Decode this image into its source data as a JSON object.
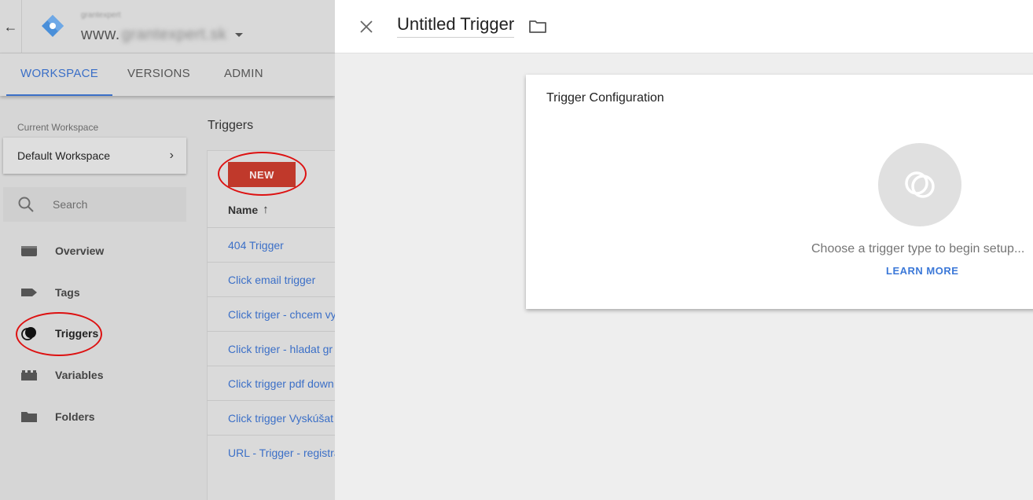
{
  "header": {
    "back_icon": "arrow-left-icon",
    "account_name": "grantexpert",
    "container_prefix": "www.",
    "container_blurred": "grantexpert.sk"
  },
  "tabs": [
    {
      "label": "WORKSPACE",
      "active": true
    },
    {
      "label": "VERSIONS",
      "active": false
    },
    {
      "label": "ADMIN",
      "active": false
    }
  ],
  "workspace": {
    "current_label": "Current Workspace",
    "name": "Default Workspace"
  },
  "search": {
    "placeholder": "Search"
  },
  "nav": [
    {
      "label": "Overview",
      "icon": "overview-icon"
    },
    {
      "label": "Tags",
      "icon": "tag-icon"
    },
    {
      "label": "Triggers",
      "icon": "trigger-icon",
      "active": true
    },
    {
      "label": "Variables",
      "icon": "variables-icon"
    },
    {
      "label": "Folders",
      "icon": "folder-icon"
    }
  ],
  "triggers_list": {
    "title": "Triggers",
    "new_label": "NEW",
    "column_name": "Name",
    "rows": [
      "404 Trigger",
      "Click email trigger",
      "Click triger - chcem vy",
      "Click triger - hladat gr",
      "Click trigger pdf down",
      "Click trigger Vyskúšat",
      "URL - Trigger - registra"
    ]
  },
  "panel": {
    "title": "Untitled Trigger",
    "config_title": "Trigger Configuration",
    "choose_text": "Choose a trigger type to begin setup...",
    "learn_more": "LEARN MORE"
  },
  "colors": {
    "accent": "#3b6fc7",
    "new_button": "#c0392b",
    "annotation": "#dd1111"
  }
}
